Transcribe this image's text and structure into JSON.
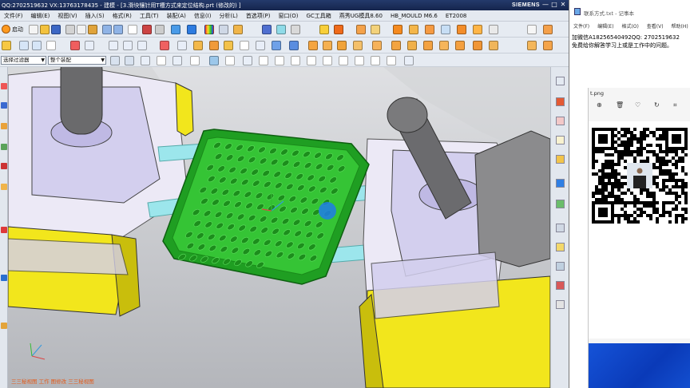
{
  "nx_window": {
    "title": "QQ:2702519632 VX:13763178435 - 建模 - [3.滑块镶针用T槽方式来定位结构.prt (修改的) ]",
    "brand": "SIEMENS",
    "controls": [
      "—",
      "□",
      "✕"
    ]
  },
  "menu": [
    "文件(F)",
    "编辑(E)",
    "视图(V)",
    "插入(S)",
    "格式(R)",
    "工具(T)",
    "装配(A)",
    "信息(I)",
    "分析(L)",
    "首选项(P)",
    "窗口(O)",
    "GC工具箱",
    "燕秀UG模具8.60",
    "HB_MOULD M6.6",
    "ET2008"
  ],
  "toolbar1": {
    "start_label": "启动"
  },
  "selection_bar": {
    "filter_value": "选择过滤器",
    "scope_value": "整个装配"
  },
  "viewport": {
    "status_text": "三三秘视图 工作 图修改 三三秘视图"
  },
  "colors": {
    "green_part": "#2fb52f",
    "yellow_slide": "#f1e61c",
    "cyan_pin": "#9be8ec",
    "lavender_block": "#c9c4e9",
    "gray_pin": "#6d6d70",
    "accent_blue": "#1677e6"
  },
  "notepad": {
    "title": "联系方式.txt - 记事本",
    "menu": [
      "文件(F)",
      "编辑(E)",
      "格式(O)",
      "查看(V)",
      "帮助(H)"
    ],
    "lines": [
      "加微信A18256540492QQ:  2702519632",
      "免费给你解答学习上或是工作中的问题。"
    ]
  },
  "photos": {
    "title": "t.png",
    "toolbar": [
      "zoom-in-icon",
      "delete-icon",
      "favorite-icon",
      "rotate-icon",
      "crop-icon"
    ]
  }
}
